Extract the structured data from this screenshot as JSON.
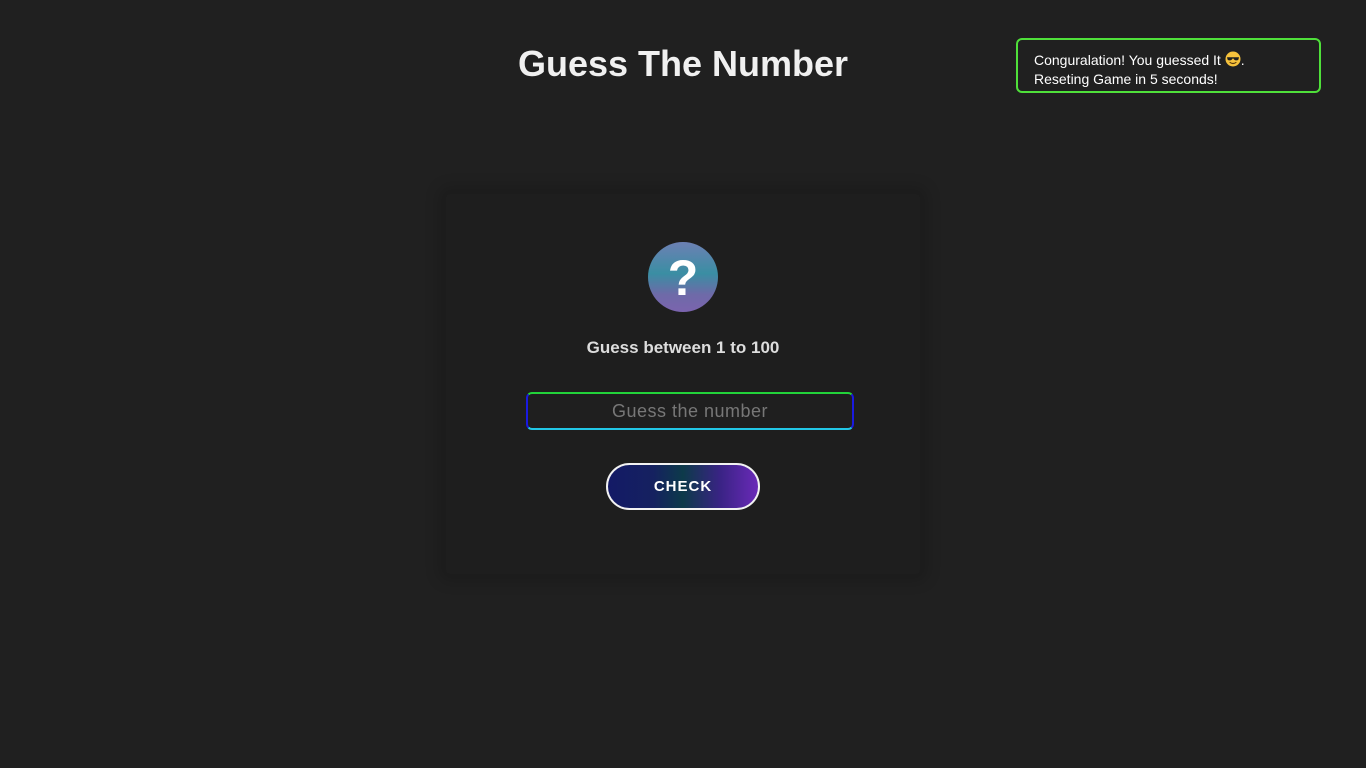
{
  "header": {
    "title": "Guess The Number"
  },
  "toast": {
    "message_prefix": "Conguralation! You guessed It",
    "message_suffix": ".",
    "emoji": "sunglasses-emoji",
    "line2": "Reseting Game in 5 seconds!",
    "border_color": "#4fe03a"
  },
  "game": {
    "question_mark": "?",
    "instruction": "Guess between 1 to 100",
    "input_placeholder": "Guess the number",
    "input_value": "",
    "check_label": "CHECK"
  },
  "colors": {
    "background": "#202020",
    "card": "#1e1e1e",
    "button_gradient_start": "#141a66",
    "button_gradient_end": "#6a2ab8"
  }
}
